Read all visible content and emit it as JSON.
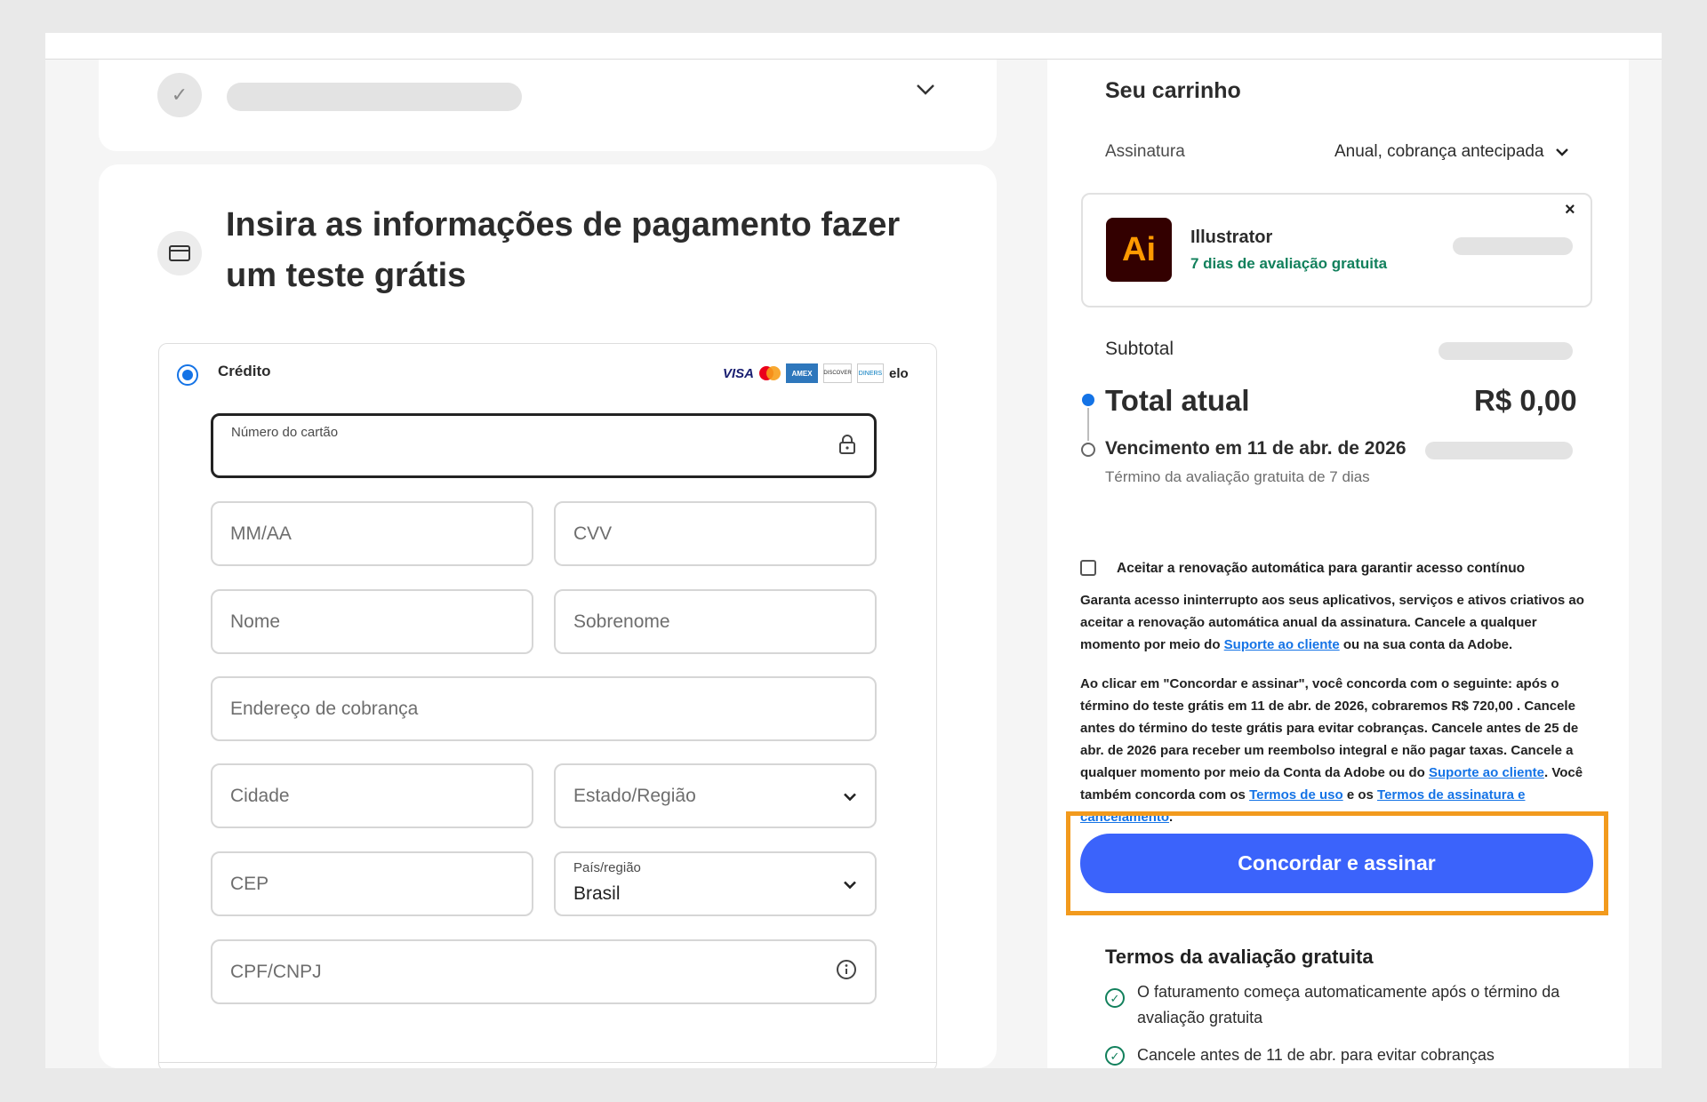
{
  "steps": {
    "collapsed_check": "✓",
    "chevron": "⌄"
  },
  "payment": {
    "title": "Insira as informações de pagamento fazer um teste grátis",
    "method_label": "Crédito",
    "card_brands": [
      "VISA",
      "AMEX",
      "DISCOVER",
      "DINERS",
      "elo"
    ],
    "fields": {
      "card_number_label": "Número do cartão",
      "expiry_placeholder": "MM/AA",
      "cvv_placeholder": "CVV",
      "first_name_placeholder": "Nome",
      "last_name_placeholder": "Sobrenome",
      "address_placeholder": "Endereço de cobrança",
      "city_placeholder": "Cidade",
      "state_placeholder": "Estado/Região",
      "zip_placeholder": "CEP",
      "country_label": "País/região",
      "country_value": "Brasil",
      "tax_id_placeholder": "CPF/CNPJ"
    }
  },
  "cart": {
    "title": "Seu carrinho",
    "subscription_label": "Assinatura",
    "subscription_value": "Anual, cobrança antecipada",
    "product": {
      "logo_text": "Ai",
      "name": "Illustrator",
      "trial": "7 dias de avaliação gratuita",
      "remove": "×"
    },
    "subtotal_label": "Subtotal",
    "total_label": "Total atual",
    "total_value": "R$ 0,00",
    "due_label": "Vencimento em 11 de abr. de 2026",
    "due_sub": "Término da avaliação gratuita de 7 dias",
    "auto_renew_label": "Aceitar a renovação automática para garantir acesso contínuo",
    "renew_text_1": "Garanta acesso ininterrupto aos seus aplicativos, serviços e ativos criativos ao aceitar a renovação automática anual da assinatura. Cancele a qualquer momento por meio do ",
    "renew_link": "Suporte ao cliente",
    "renew_text_2": " ou na sua conta da Adobe.",
    "legal_1": "Ao clicar em \"Concordar e assinar\", você concorda com o seguinte: após o término do teste grátis em 11 de abr. de 2026, cobraremos R$ 720,00 . Cancele antes do término do teste grátis para evitar cobranças. Cancele antes de 25 de abr. de 2026 para receber um reembolso integral e não pagar taxas. Cancele a qualquer momento por meio da Conta da Adobe ou do ",
    "legal_link_support": "Suporte ao cliente",
    "legal_2": ". Você também concorda com os ",
    "legal_link_terms": "Termos de uso",
    "legal_3": " e os ",
    "legal_link_sub_terms": "Termos de assinatura e cancelamento",
    "legal_4": ".",
    "cta_label": "Concordar e assinar",
    "trial_terms_title": "Termos da avaliação gratuita",
    "trial_terms": [
      "O faturamento começa automaticamente após o término da avaliação gratuita",
      "Cancele antes de 11 de abr. para evitar cobranças"
    ]
  }
}
